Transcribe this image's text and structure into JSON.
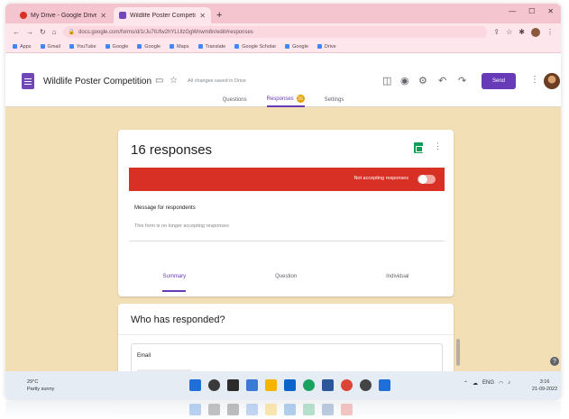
{
  "browser": {
    "tabs": [
      {
        "title": "My Drive - Google Drive",
        "active": false,
        "icon": "drive-icon"
      },
      {
        "title": "Wildlife Poster Competition - Google Forms",
        "active": true,
        "icon": "forms-icon"
      }
    ],
    "url": "docs.google.com/forms/d/1rJu7tUfw2hYLUlzGgWnwm8n/edit#responses",
    "bookmarks": [
      "Apps",
      "Gmail",
      "YouTube",
      "Google",
      "Google",
      "Maps",
      "Translate",
      "Google Scholar",
      "Google",
      "Drive"
    ]
  },
  "forms_header": {
    "title": "Wildlife Poster Competition",
    "saved_msg": "All changes saved in Drive",
    "send_label": "Send",
    "tabs": [
      {
        "label": "Questions",
        "active": false
      },
      {
        "label": "Responses",
        "active": true,
        "badge": "16"
      },
      {
        "label": "Settings",
        "active": false
      }
    ]
  },
  "responses_card": {
    "title": "16 responses",
    "not_accepting_label": "Not accepting responses",
    "accepting": false,
    "message_label": "Message for respondents",
    "message_value": "This form is no longer accepting responses",
    "subtabs": [
      {
        "label": "Summary",
        "active": true
      },
      {
        "label": "Question",
        "active": false
      },
      {
        "label": "Individual",
        "active": false
      }
    ]
  },
  "who_card": {
    "title": "Who has responded?",
    "email_label": "Email"
  },
  "taskbar": {
    "weather_temp": "29°C",
    "weather_desc": "Partly sunny",
    "time": "3:16",
    "date": "21-09-2022",
    "lang": "ENG"
  },
  "colors": {
    "forms_purple": "#673ab7",
    "red_bar": "#d93025",
    "page_bg": "#f3dfb6"
  }
}
